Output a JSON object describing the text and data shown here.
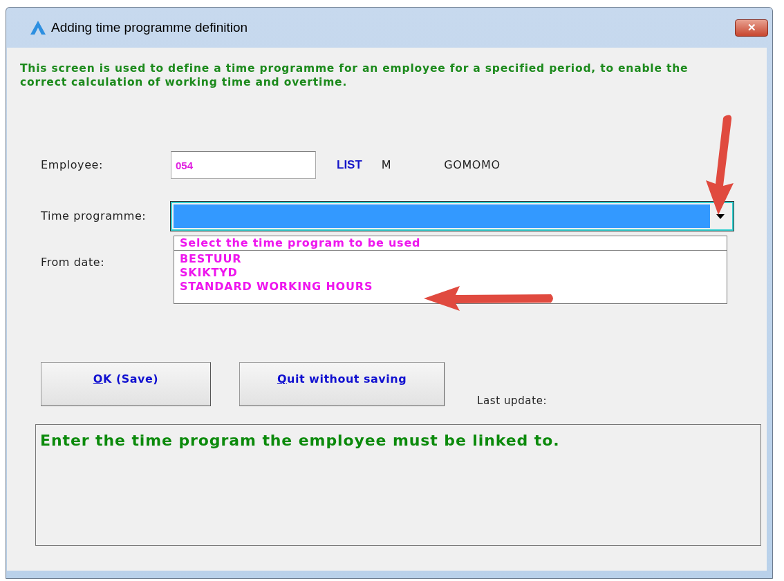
{
  "window": {
    "title": "Adding time programme definition",
    "close": "✕"
  },
  "intro": "This screen is used to define a time programme for an employee for a specified period, to enable the correct calculation of working time and overtime.",
  "employee": {
    "label": "Employee:",
    "value": "054",
    "list_link": "LIST",
    "gender": "M",
    "name": "GOMOMO"
  },
  "time_programme": {
    "label": "Time programme:",
    "highlighted": true,
    "expanded": true,
    "options": [
      {
        "label": "Select the time program to be used",
        "kind": "header"
      },
      {
        "label": "BESTUUR",
        "kind": "item"
      },
      {
        "label": "SKIKTYD",
        "kind": "item"
      },
      {
        "label": "STANDARD WORKING HOURS",
        "kind": "item"
      }
    ]
  },
  "from_date": {
    "label": "From date:"
  },
  "buttons": [
    {
      "label": "OK (Save)",
      "mnemonic": true
    },
    {
      "label": "Quit without saving",
      "mnemonic": true
    }
  ],
  "last_update": {
    "label": "Last update:"
  },
  "message": "Enter the time program the employee must be linked to.",
  "annotations": [
    {
      "kind": "arrow-down"
    },
    {
      "kind": "arrow-left"
    }
  ]
}
